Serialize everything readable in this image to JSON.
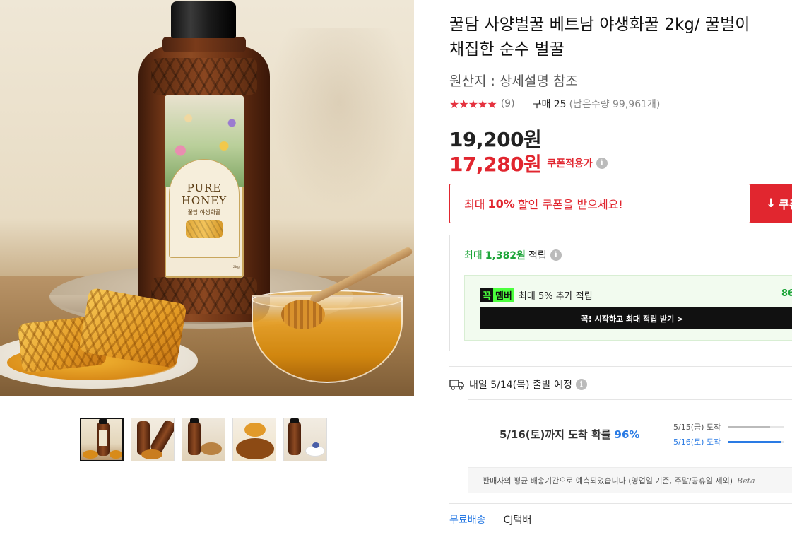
{
  "product": {
    "title_line1": "꿀담 사양벌꿀 베트남 야생화꿀 2kg/ 꿀벌이",
    "title_line2": "채집한 순수 벌꿀",
    "origin": "원산지 : 상세설명 참조",
    "rating_stars": "★★★★★",
    "rating_value": 5,
    "review_count": "(9)",
    "purchase_count": "구매 25",
    "remaining_stock": "(남은수량 99,961개)",
    "original_price": "19,200원",
    "sale_price": "17,280원",
    "coupon_available": "쿠폰적용가",
    "info_glyph": "i"
  },
  "image_label": {
    "pure": "PURE",
    "honey": "HONEY",
    "brand": "꿀담 야생화꿀",
    "weight": "2kg"
  },
  "coupon": {
    "prefix": "최대",
    "percent": "10%",
    "suffix": "할인 쿠폰을 받으세요!",
    "button_label": "쿠폰",
    "download_icon": "↓"
  },
  "points": {
    "prefix": "최대",
    "amount": "1,382원",
    "suffix": "적립",
    "member_tag_a": "꼭",
    "member_tag_b": "멤버",
    "member_text": "최대 5% 추가 적립",
    "member_amount": "86",
    "member_cta": "꼭! 시작하고 최대 적립 받기 >"
  },
  "shipping": {
    "departure": "내일 5/14(목) 출발 예정",
    "arrival_main": "5/16(토)까지 도착 확률",
    "arrival_pct": "96%",
    "distribution": [
      {
        "label": "5/15(금) 도착",
        "share": 0.75,
        "highlight": false
      },
      {
        "label": "5/16(토) 도착",
        "share": 0.96,
        "highlight": true
      }
    ],
    "footnote": "판매자의 평균 배송기간으로 예측되었습니다 (영업일 기준, 주말/공휴일 제외)",
    "beta": "Beta",
    "free_shipping": "무료배송",
    "courier": "CJ택배"
  },
  "thumbnails": [
    {
      "name": "thumb-bottle",
      "active": true
    },
    {
      "name": "thumb-pouring",
      "active": false
    },
    {
      "name": "thumb-nuts",
      "active": false
    },
    {
      "name": "thumb-dipper",
      "active": false
    },
    {
      "name": "thumb-breakfast",
      "active": false
    }
  ],
  "colors": {
    "accent_red": "#e1262f",
    "points_green": "#1ea53a",
    "member_green": "#4bff3d",
    "link_blue": "#2a7be4"
  }
}
